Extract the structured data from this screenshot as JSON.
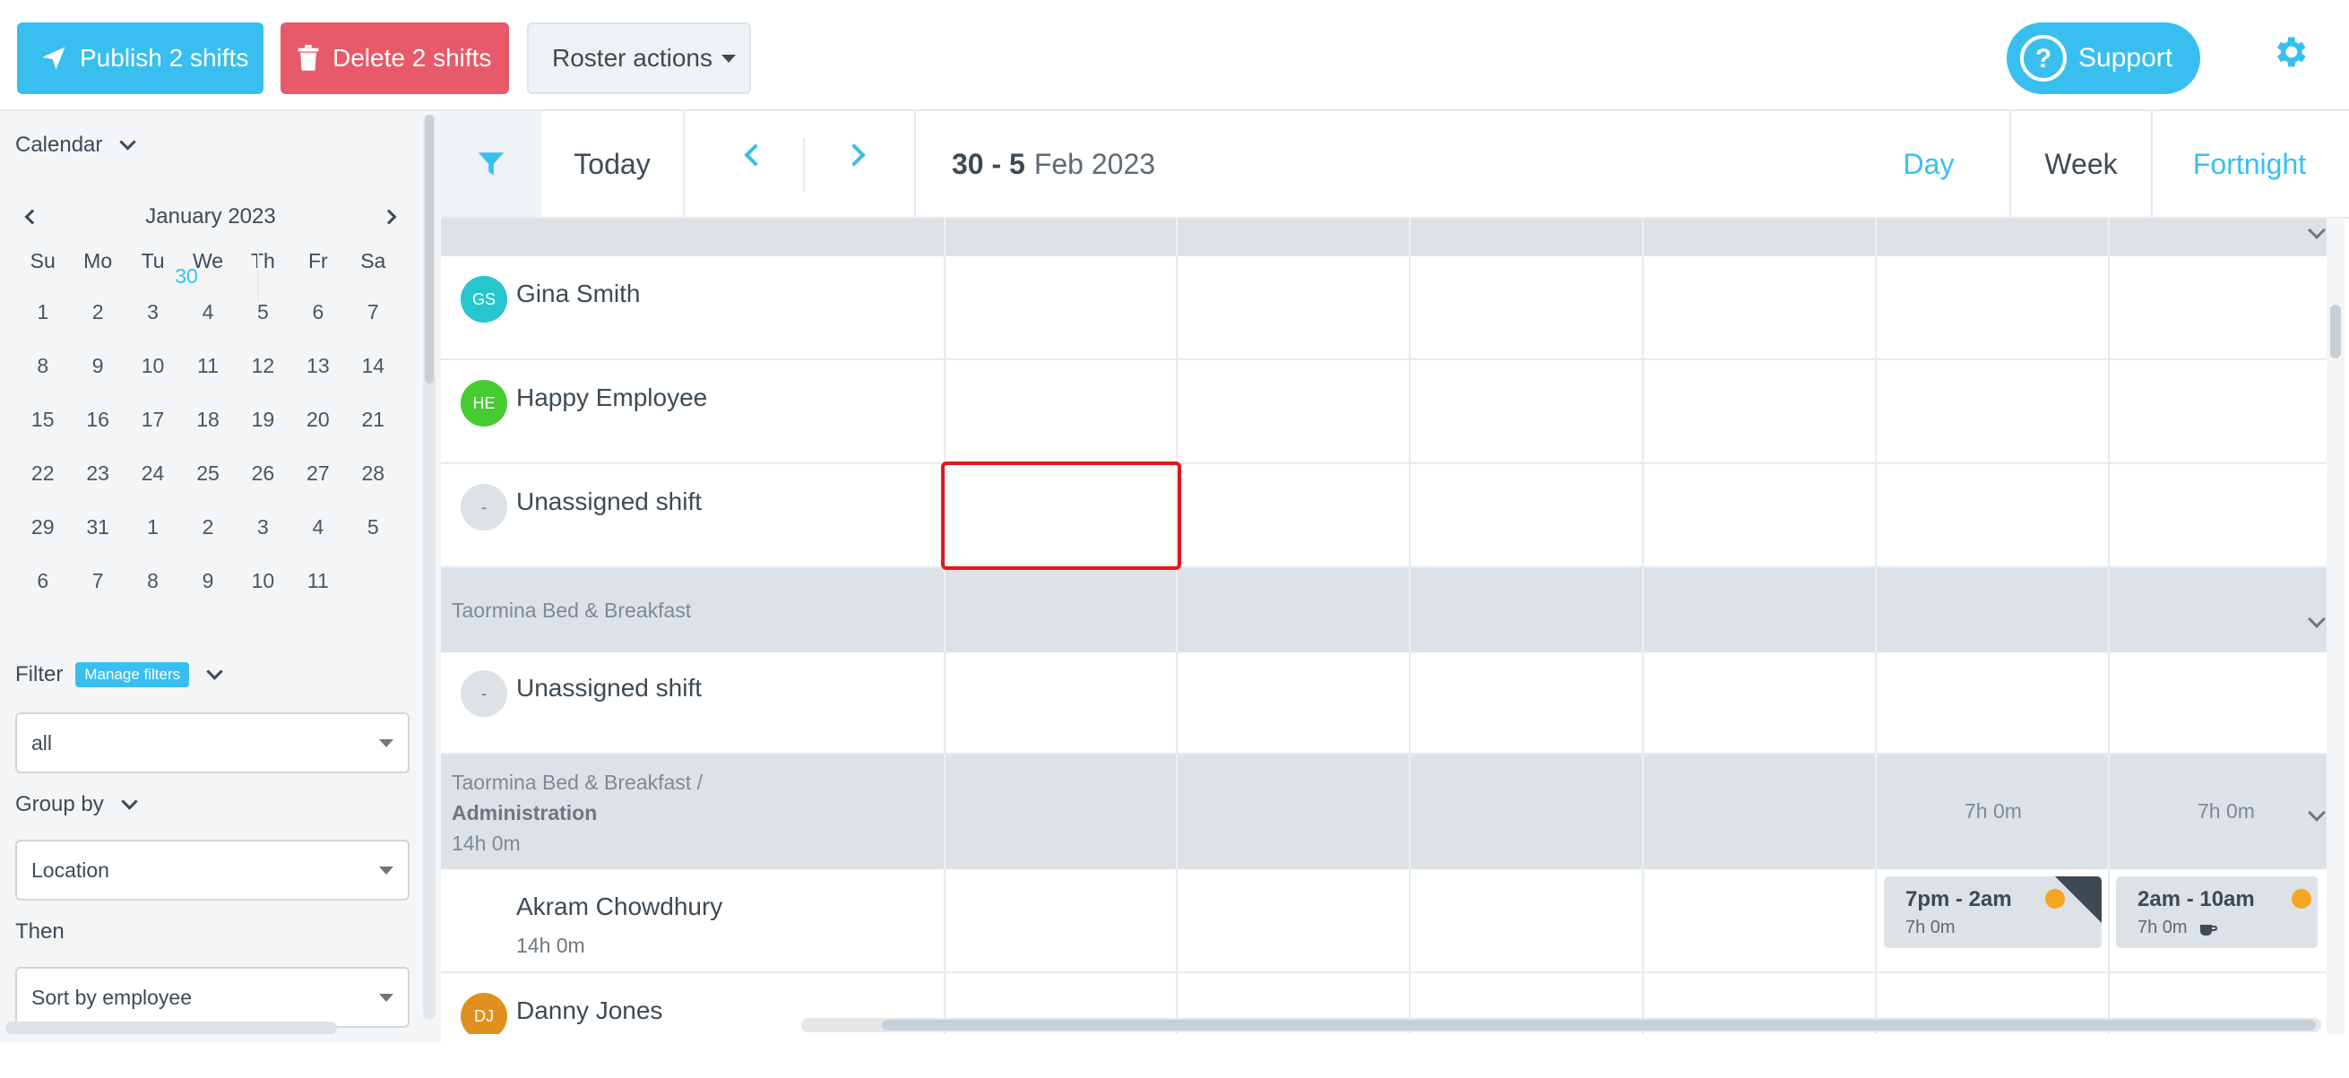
{
  "toolbar": {
    "publish_label": "Publish 2 shifts",
    "delete_label": "Delete 2 shifts",
    "roster_actions_label": "Roster actions",
    "support_label": "Support"
  },
  "sidebar": {
    "calendar_label": "Calendar",
    "month_label": "January 2023",
    "weekdays": [
      "Su",
      "Mo",
      "Tu",
      "We",
      "Th",
      "Fr",
      "Sa"
    ],
    "weeks": [
      [
        "1",
        "2",
        "3",
        "4",
        "5",
        "6",
        "7"
      ],
      [
        "8",
        "9",
        "10",
        "11",
        "12",
        "13",
        "14"
      ],
      [
        "15",
        "16",
        "17",
        "18",
        "19",
        "20",
        "21"
      ],
      [
        "22",
        "23",
        "24",
        "25",
        "26",
        "27",
        "28"
      ],
      [
        "29",
        "30",
        "31",
        "1",
        "2",
        "3",
        "4"
      ],
      [
        "5",
        "6",
        "7",
        "8",
        "9",
        "10",
        "11"
      ]
    ],
    "today_date": "30",
    "filter_label": "Filter",
    "manage_filters_label": "Manage filters",
    "filter_value": "all",
    "group_by_label": "Group by",
    "group_by_value": "Location",
    "then_label": "Then",
    "then_value": "Sort by employee"
  },
  "roster_header": {
    "today_label": "Today",
    "date_range_bold": "30 - 5",
    "date_range_rest": "Feb 2023",
    "views": {
      "day": "Day",
      "week": "Week",
      "fortnight": "Fortnight"
    },
    "active_view": "Week"
  },
  "rows": {
    "gina": {
      "initials": "GS",
      "name": "Gina Smith",
      "color": "#26c6cf"
    },
    "happy": {
      "initials": "HE",
      "name": "Happy Employee",
      "color": "#46cc2e"
    },
    "unassigned1": {
      "initials": "-",
      "name": "Unassigned shift"
    },
    "group_taormina": {
      "label": "Taormina Bed & Breakfast"
    },
    "unassigned2": {
      "initials": "-",
      "name": "Unassigned shift"
    },
    "group_admin": {
      "label_line1": "Taormina Bed & Breakfast /",
      "label_line2": "Administration",
      "total": "14h 0m",
      "day_totals": [
        "7h 0m",
        "7h 0m"
      ]
    },
    "akram": {
      "name": "Akram Chowdhury",
      "total": "14h 0m",
      "shifts": [
        {
          "time": "7pm - 2am",
          "hours": "7h 0m"
        },
        {
          "time": "2am - 10am",
          "hours": "7h 0m"
        }
      ]
    },
    "danny": {
      "initials": "DJ",
      "name": "Danny Jones",
      "color": "#e0901e"
    }
  },
  "colors": {
    "accent": "#38bff0",
    "danger": "#e85a69",
    "highlight": "#e3161c"
  },
  "icons": [
    "paper-plane-icon",
    "trash-icon",
    "question-icon",
    "gear-icon",
    "filter-icon",
    "moon-icon",
    "pencil-icon",
    "coffee-icon"
  ]
}
